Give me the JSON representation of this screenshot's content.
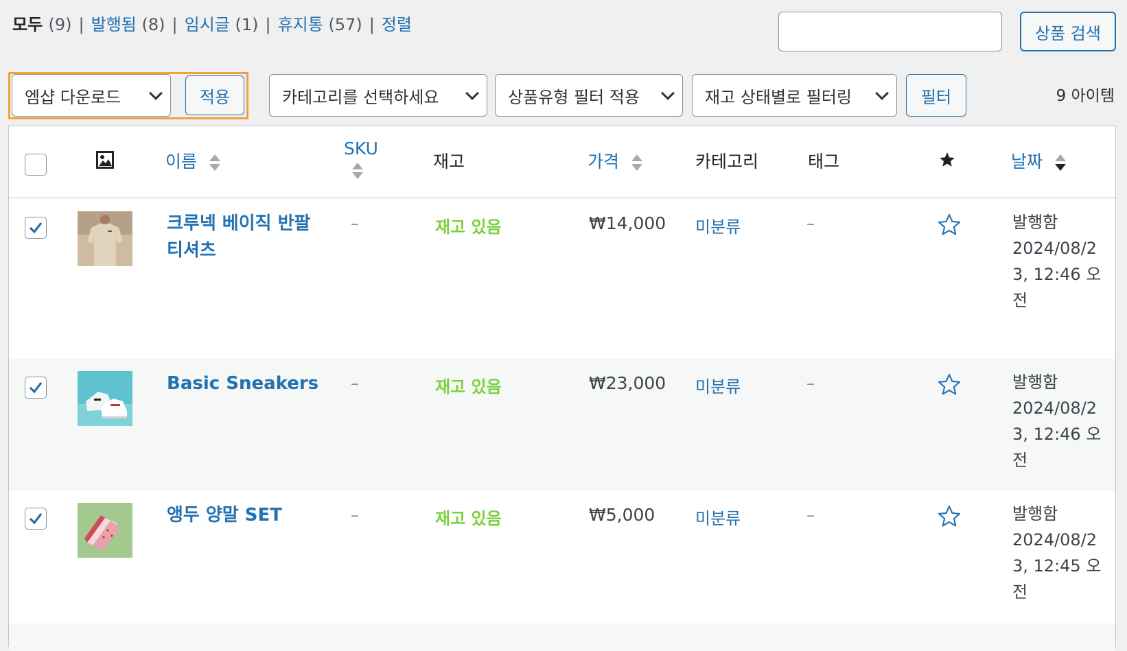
{
  "views": {
    "all_label": "모두",
    "all_count": "(9)",
    "published_label": "발행됨",
    "published_count": "(8)",
    "draft_label": "임시글",
    "draft_count": "(1)",
    "trash_label": "휴지통",
    "trash_count": "(57)",
    "sort_label": "정렬",
    "separator": "|"
  },
  "search": {
    "value": "",
    "button_label": "상품 검색"
  },
  "filters": {
    "bulk_action": "엠샵 다운로드",
    "apply_label": "적용",
    "category": "카테고리를 선택하세요",
    "product_type": "상품유형 필터 적용",
    "stock_status": "재고 상태별로 필터링",
    "filter_label": "필터",
    "items_count": "9 아이템"
  },
  "columns": {
    "name": "이름",
    "sku": "SKU",
    "stock": "재고",
    "price": "가격",
    "categories": "카테고리",
    "tags": "태그",
    "date": "날짜"
  },
  "rows": [
    {
      "name": "크루넥 베이직 반팔 티셔츠",
      "sku": "–",
      "stock": "재고 있음",
      "price": "₩14,000",
      "category": "미분류",
      "tags": "–",
      "status": "발행함",
      "date": "2024/08/23, 12:46 오전",
      "checked": true,
      "featured": false
    },
    {
      "name": "Basic Sneakers",
      "sku": "–",
      "stock": "재고 있음",
      "price": "₩23,000",
      "category": "미분류",
      "tags": "–",
      "status": "발행함",
      "date": "2024/08/23, 12:46 오전",
      "checked": true,
      "featured": false
    },
    {
      "name": "앵두 양말 SET",
      "sku": "–",
      "stock": "재고 있음",
      "price": "₩5,000",
      "category": "미분류",
      "tags": "–",
      "status": "발행함",
      "date": "2024/08/23, 12:45 오전",
      "checked": true,
      "featured": false
    }
  ],
  "colors": {
    "link": "#2271b1",
    "in_stock": "#7ad03a",
    "focus_outline": "#f0a03c"
  }
}
